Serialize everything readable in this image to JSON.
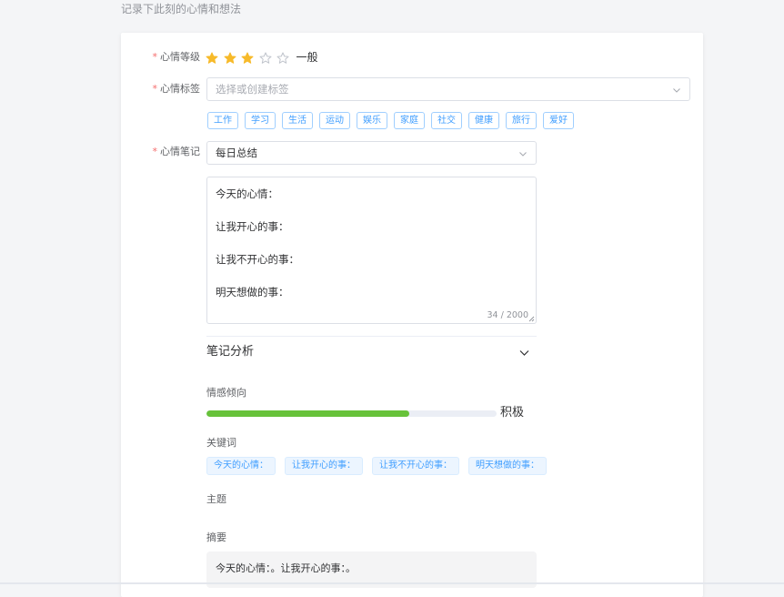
{
  "page": {
    "subtitle": "记录下此刻的心情和想法"
  },
  "form": {
    "mood_level": {
      "label": "心情等级",
      "required_mark": "*",
      "rating": 3,
      "max": 5,
      "rating_text": "一般",
      "star_active_color": "#f7ba2a",
      "star_inactive_color": "#c0c4cc"
    },
    "mood_tags": {
      "label": "心情标签",
      "required_mark": "*",
      "placeholder": "选择或创建标签",
      "suggestions": [
        "工作",
        "学习",
        "生活",
        "运动",
        "娱乐",
        "家庭",
        "社交",
        "健康",
        "旅行",
        "爱好"
      ]
    },
    "mood_note": {
      "label": "心情笔记",
      "required_mark": "*",
      "template_value": "每日总结",
      "content_lines": [
        "今天的心情：",
        "让我开心的事：",
        "让我不开心的事：",
        "明天想做的事："
      ],
      "char_count": "34 / 2000"
    }
  },
  "analysis": {
    "title": "笔记分析",
    "sentiment": {
      "label": "情感倾向",
      "value": 0.7,
      "text": "积极",
      "bar_color": "#67c23a"
    },
    "keywords": {
      "label": "关键词",
      "items": [
        "今天的心情：",
        "让我开心的事：",
        "让我不开心的事：",
        "明天想做的事："
      ]
    },
    "topic": {
      "label": "主题"
    },
    "summary": {
      "label": "摘要",
      "text": "今天的心情：。让我开心的事：。"
    }
  }
}
